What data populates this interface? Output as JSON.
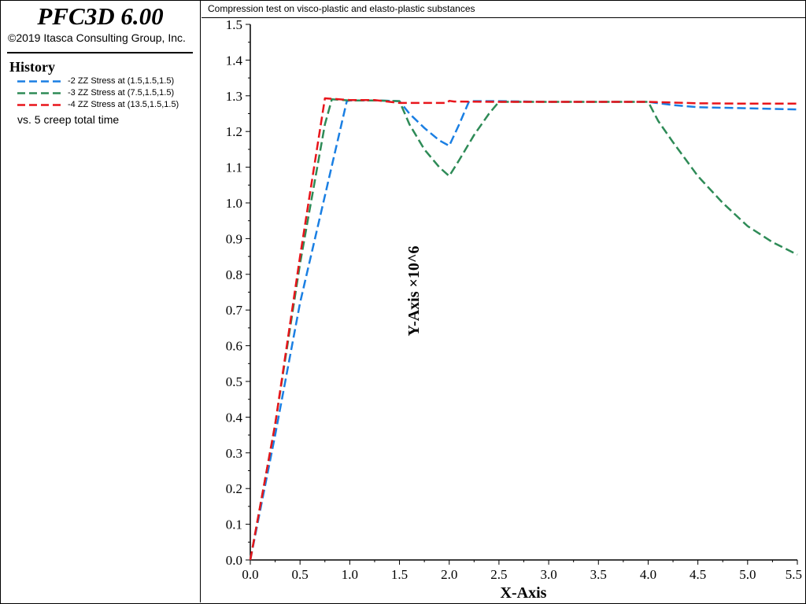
{
  "app": {
    "title": "PFC3D 6.00",
    "copyright": "©2019 Itasca Consulting Group, Inc."
  },
  "legend": {
    "heading": "History",
    "items": [
      {
        "label": "-2 ZZ Stress at (1.5,1.5,1.5)",
        "color": "#1a7fe3"
      },
      {
        "label": "-3 ZZ Stress at (7.5,1.5,1.5)",
        "color": "#2e8b57"
      },
      {
        "label": "-4 ZZ Stress at (13.5,1.5,1.5)",
        "color": "#e8151b"
      }
    ],
    "vs_text": "vs. 5 creep total time"
  },
  "chart_data": {
    "type": "line",
    "title": "Compression test on visco-plastic and elasto-plastic substances",
    "xlabel": "X-Axis",
    "ylabel": "Y-Axis ×10^6",
    "xlim": [
      0.0,
      5.5
    ],
    "ylim": [
      0.0,
      1.5
    ],
    "x_ticks": [
      "0.0",
      "0.5",
      "1.0",
      "1.5",
      "2.0",
      "2.5",
      "3.0",
      "3.5",
      "4.0",
      "4.5",
      "5.0",
      "5.5"
    ],
    "y_ticks": [
      "0.0",
      "0.1",
      "0.2",
      "0.3",
      "0.4",
      "0.5",
      "0.6",
      "0.7",
      "0.8",
      "0.9",
      "1.0",
      "1.1",
      "1.2",
      "1.3",
      "1.4",
      "1.5"
    ],
    "line_style": "dashed",
    "series": [
      {
        "name": "-2 ZZ Stress at (1.5,1.5,1.5)",
        "color": "#1a7fe3",
        "points": [
          [
            0.0,
            0.0
          ],
          [
            0.25,
            0.35
          ],
          [
            0.5,
            0.72
          ],
          [
            0.75,
            1.02
          ],
          [
            0.97,
            1.285
          ],
          [
            1.0,
            1.287
          ],
          [
            1.25,
            1.287
          ],
          [
            1.5,
            1.285
          ],
          [
            1.6,
            1.25
          ],
          [
            1.75,
            1.21
          ],
          [
            1.9,
            1.175
          ],
          [
            2.0,
            1.16
          ],
          [
            2.1,
            1.22
          ],
          [
            2.2,
            1.285
          ],
          [
            2.5,
            1.285
          ],
          [
            3.0,
            1.283
          ],
          [
            3.5,
            1.283
          ],
          [
            4.0,
            1.283
          ],
          [
            4.25,
            1.274
          ],
          [
            4.5,
            1.268
          ],
          [
            5.0,
            1.265
          ],
          [
            5.5,
            1.262
          ]
        ]
      },
      {
        "name": "-3 ZZ Stress at (7.5,1.5,1.5)",
        "color": "#2e8b57",
        "points": [
          [
            0.0,
            0.0
          ],
          [
            0.25,
            0.38
          ],
          [
            0.5,
            0.83
          ],
          [
            0.75,
            1.22
          ],
          [
            0.82,
            1.29
          ],
          [
            1.0,
            1.287
          ],
          [
            1.25,
            1.287
          ],
          [
            1.5,
            1.285
          ],
          [
            1.6,
            1.22
          ],
          [
            1.75,
            1.15
          ],
          [
            1.9,
            1.1
          ],
          [
            2.0,
            1.075
          ],
          [
            2.1,
            1.12
          ],
          [
            2.25,
            1.19
          ],
          [
            2.4,
            1.25
          ],
          [
            2.5,
            1.283
          ],
          [
            3.0,
            1.283
          ],
          [
            3.5,
            1.283
          ],
          [
            4.0,
            1.283
          ],
          [
            4.1,
            1.23
          ],
          [
            4.25,
            1.17
          ],
          [
            4.5,
            1.075
          ],
          [
            4.75,
            1.0
          ],
          [
            5.0,
            0.935
          ],
          [
            5.25,
            0.89
          ],
          [
            5.5,
            0.855
          ]
        ]
      },
      {
        "name": "-4 ZZ Stress at (13.5,1.5,1.5)",
        "color": "#e8151b",
        "points": [
          [
            0.0,
            0.0
          ],
          [
            0.25,
            0.38
          ],
          [
            0.5,
            0.85
          ],
          [
            0.75,
            1.293
          ],
          [
            1.0,
            1.288
          ],
          [
            1.25,
            1.288
          ],
          [
            1.5,
            1.28
          ],
          [
            1.75,
            1.28
          ],
          [
            1.98,
            1.28
          ],
          [
            2.0,
            1.286
          ],
          [
            2.05,
            1.284
          ],
          [
            2.5,
            1.283
          ],
          [
            3.0,
            1.283
          ],
          [
            3.5,
            1.283
          ],
          [
            4.0,
            1.283
          ],
          [
            4.5,
            1.279
          ],
          [
            5.0,
            1.278
          ],
          [
            5.5,
            1.278
          ]
        ]
      }
    ]
  }
}
